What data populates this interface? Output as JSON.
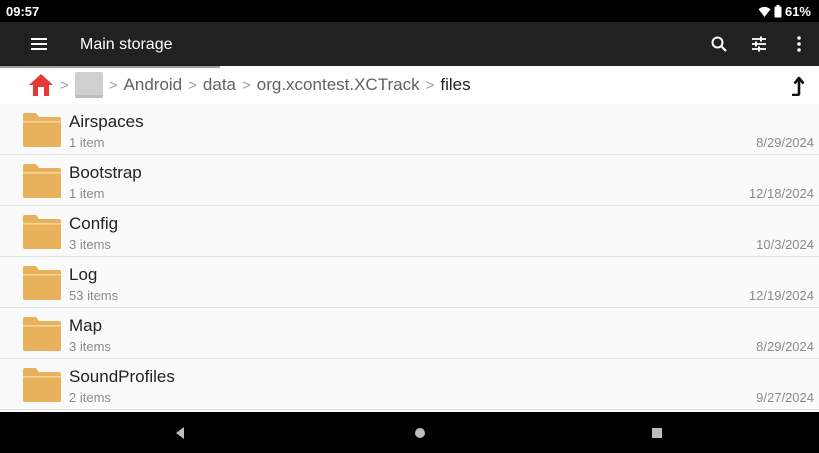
{
  "status_bar": {
    "time": "09:57",
    "battery": "61%"
  },
  "app_bar": {
    "title": "Main storage"
  },
  "breadcrumb": {
    "items": [
      "Android",
      "data",
      "org.xcontest.XCTrack",
      "files"
    ]
  },
  "files": [
    {
      "name": "Airspaces",
      "count": "1 item",
      "date": "8/29/2024"
    },
    {
      "name": "Bootstrap",
      "count": "1 item",
      "date": "12/18/2024"
    },
    {
      "name": "Config",
      "count": "3 items",
      "date": "10/3/2024"
    },
    {
      "name": "Log",
      "count": "53 items",
      "date": "12/19/2024"
    },
    {
      "name": "Map",
      "count": "3 items",
      "date": "8/29/2024"
    },
    {
      "name": "SoundProfiles",
      "count": "2 items",
      "date": "9/27/2024"
    }
  ],
  "colors": {
    "app_bar": "#212121",
    "folder": "#e8b25d",
    "home": "#e53935"
  }
}
